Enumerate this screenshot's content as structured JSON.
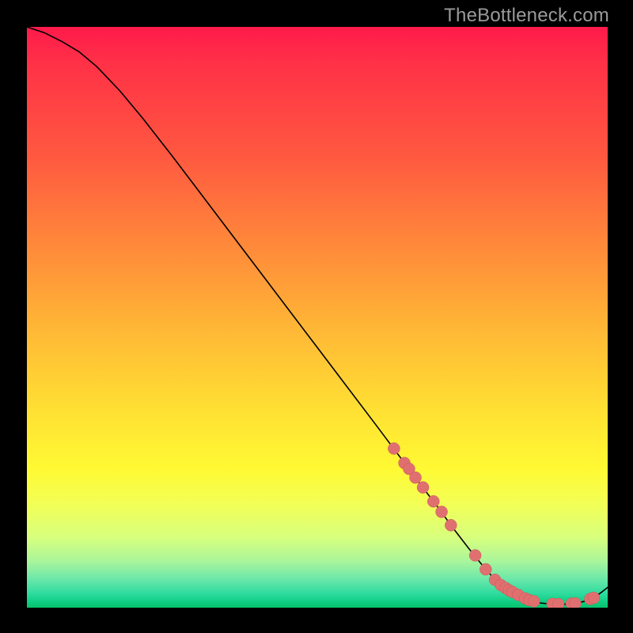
{
  "watermark": "TheBottleneck.com",
  "colors": {
    "background": "#000000",
    "curve": "#000000",
    "dot_fill": "#e07070",
    "dot_stroke": "#c85858",
    "watermark": "#9a9a9a"
  },
  "chart_data": {
    "type": "line",
    "title": "",
    "xlabel": "",
    "ylabel": "",
    "xlim": [
      0,
      100
    ],
    "ylim": [
      0,
      100
    ],
    "grid": false,
    "legend": false,
    "x": [
      0,
      3,
      6,
      9,
      12,
      16,
      20,
      25,
      30,
      35,
      40,
      45,
      50,
      55,
      60,
      63,
      66,
      69,
      71,
      73,
      76,
      78.5,
      80,
      82,
      84,
      85.5,
      87,
      88,
      89.5,
      91.5,
      93,
      94,
      95,
      96,
      97,
      98,
      99,
      100
    ],
    "y": [
      100,
      99,
      97.5,
      95.7,
      93.2,
      89,
      84.2,
      77.8,
      71.2,
      64.6,
      58,
      51.4,
      44.8,
      38.2,
      31.6,
      27.6,
      23.6,
      19.6,
      17,
      14.2,
      10.3,
      7.2,
      5.5,
      3.6,
      2.3,
      1.6,
      1.1,
      0.85,
      0.7,
      0.6,
      0.6,
      0.7,
      0.85,
      1.1,
      1.5,
      2.0,
      2.7,
      3.5
    ],
    "series_dots": {
      "x": [
        63.2,
        65.0,
        65.8,
        66.9,
        68.2,
        70.0,
        71.4,
        73.0,
        77.2,
        79.0,
        80.6,
        81.6,
        82.4,
        83.0,
        83.6,
        84.6,
        85.8,
        86.5,
        87.3,
        90.5,
        91.5,
        93.8,
        94.4,
        97.0,
        97.6
      ],
      "y": [
        27.4,
        24.9,
        23.9,
        22.4,
        20.7,
        18.3,
        16.5,
        14.2,
        9.0,
        6.6,
        4.8,
        3.9,
        3.4,
        3.0,
        2.7,
        2.2,
        1.6,
        1.3,
        1.1,
        0.65,
        0.6,
        0.7,
        0.75,
        1.5,
        1.7
      ]
    }
  }
}
